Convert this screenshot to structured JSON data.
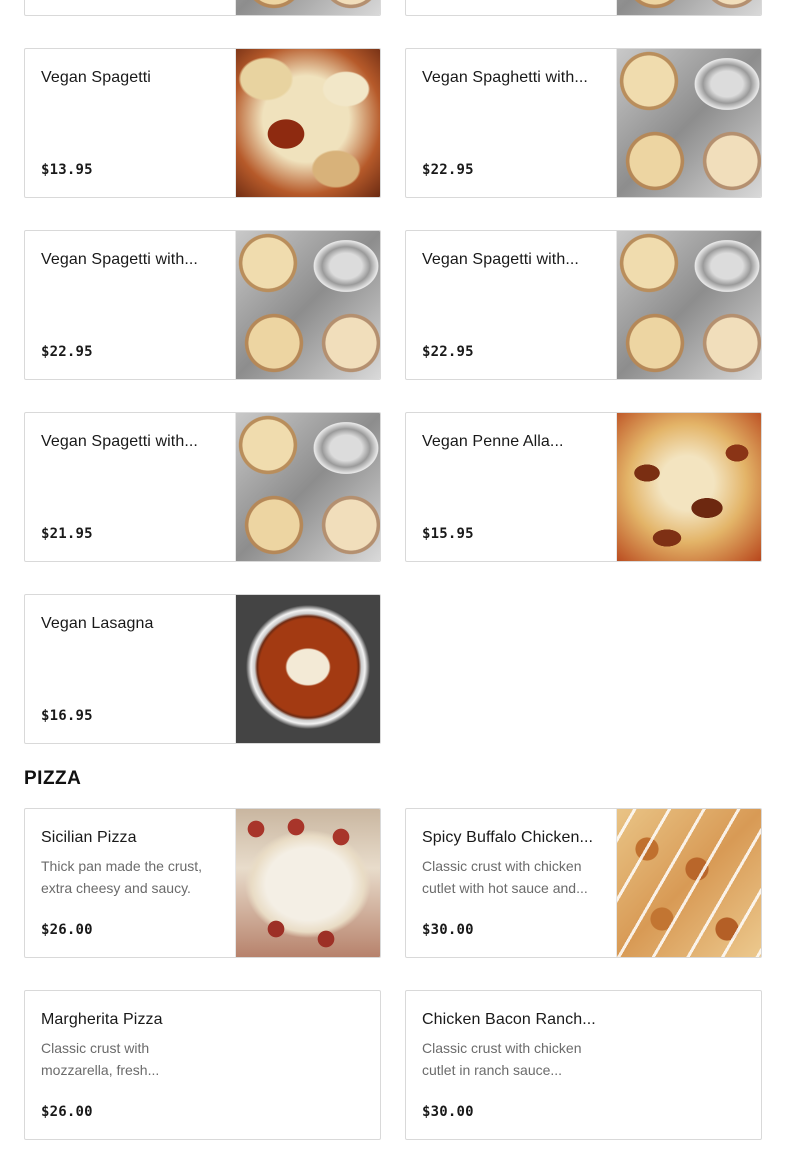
{
  "sections": {
    "pizza_title": "PIZZA"
  },
  "items": [
    {
      "name": "Vegan Spagetti",
      "description": "",
      "price": "$13.95",
      "image": "sauce"
    },
    {
      "name": "Vegan Spaghetti with...",
      "description": "",
      "price": "$22.95",
      "image": "trays"
    },
    {
      "name": "Vegan Spagetti with...",
      "description": "",
      "price": "$22.95",
      "image": "trays"
    },
    {
      "name": "Vegan Spagetti with...",
      "description": "",
      "price": "$22.95",
      "image": "trays"
    },
    {
      "name": "Vegan Spagetti with...",
      "description": "",
      "price": "$21.95",
      "image": "trays"
    },
    {
      "name": "Vegan Penne Alla...",
      "description": "",
      "price": "$15.95",
      "image": "penne"
    },
    {
      "name": "Vegan Lasagna",
      "description": "",
      "price": "$16.95",
      "image": "lasagna"
    }
  ],
  "pizza_items": [
    {
      "name": "Sicilian Pizza",
      "description": "Thick pan made the crust, extra cheesy and saucy.",
      "price": "$26.00",
      "image": "sicilian"
    },
    {
      "name": "Spicy Buffalo Chicken...",
      "description": "Classic crust with chicken cutlet with hot sauce and...",
      "price": "$30.00",
      "image": "buffalo"
    },
    {
      "name": "Margherita Pizza",
      "description": "Classic crust with mozzarella, fresh...",
      "price": "$26.00",
      "image": ""
    },
    {
      "name": "Chicken Bacon Ranch...",
      "description": "Classic crust with chicken cutlet in ranch sauce...",
      "price": "$30.00",
      "image": ""
    }
  ],
  "colors": {
    "border": "#d9d9d9",
    "text": "#191919",
    "muted": "#6b6b6b"
  }
}
